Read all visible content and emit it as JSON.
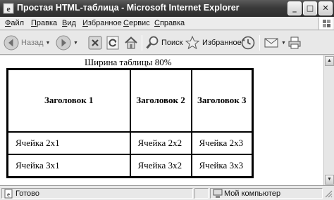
{
  "window": {
    "title": "Простая HTML-таблица - Microsoft Internet Explorer",
    "buttons": {
      "minimize": "_",
      "maximize": "□",
      "close": "✕"
    }
  },
  "menu": [
    {
      "pre": "",
      "key": "Ф",
      "post": "айл"
    },
    {
      "pre": "",
      "key": "П",
      "post": "равка"
    },
    {
      "pre": "",
      "key": "В",
      "post": "ид"
    },
    {
      "pre": "",
      "key": "И",
      "post": "збранное"
    },
    {
      "pre": "",
      "key": "С",
      "post": "ервис"
    },
    {
      "pre": "",
      "key": "С",
      "post": "правка"
    }
  ],
  "toolbar": {
    "back": "Назад",
    "search": "Поиск",
    "favorites": "Избранное",
    "caret": "▼"
  },
  "page": {
    "caption": "Ширина таблицы 80%",
    "header": [
      "Заголовок 1",
      "Заголовок 2",
      "Заголовок 3"
    ],
    "rows": [
      [
        "Ячейка 2x1",
        "Ячейка 2x2",
        "Ячейка 2x3"
      ],
      [
        "Ячейка 3x1",
        "Ячейка 3x2",
        "Ячейка 3x3"
      ]
    ]
  },
  "scrollbar": {
    "up": "▲",
    "down": "▼"
  },
  "status": {
    "left": "Готово",
    "zone": "Мой компьютер"
  },
  "colors": {
    "titlebar": "#3a3a3a",
    "menubar": "#ececec",
    "toolbar": "#e8e8e8",
    "content": "#ffffff",
    "table_border": "#000000"
  },
  "icons": [
    "ie-icon",
    "back-icon",
    "forward-icon",
    "stop-icon",
    "refresh-icon",
    "home-icon",
    "search-icon",
    "favorites-star-icon",
    "history-icon",
    "mail-icon",
    "print-icon",
    "windows-logo-icon",
    "page-icon",
    "computer-icon",
    "resize-grip-icon"
  ]
}
